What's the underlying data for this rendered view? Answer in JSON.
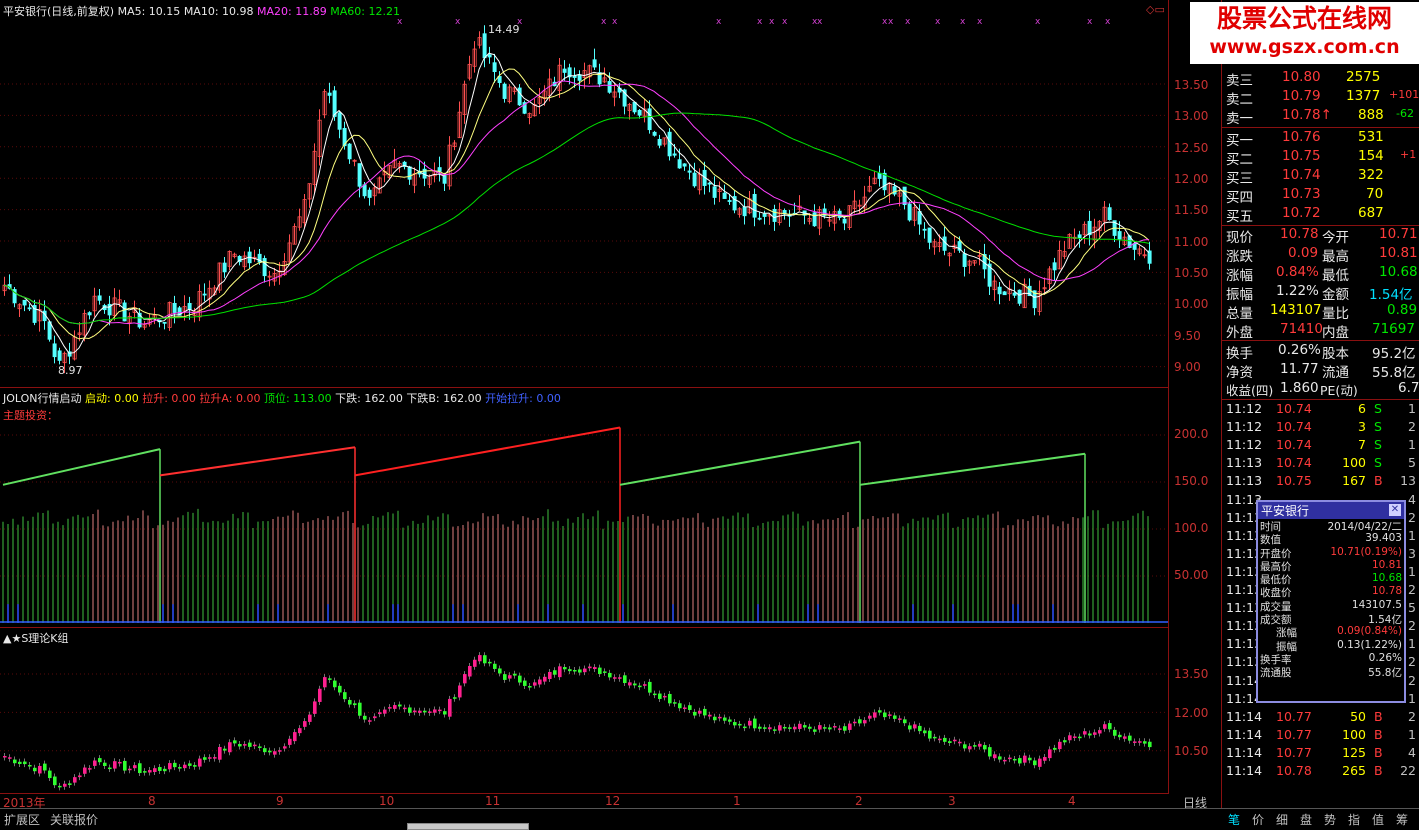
{
  "main_chart": {
    "stock_label": "平安银行(日线,前复权)",
    "ma5": "MA5: 10.15",
    "ma10": "MA10: 10.98",
    "ma20": "MA20: 11.89",
    "ma60": "MA60: 12.21",
    "high_mark": "14.49",
    "low_mark": "8.97",
    "y_ticks": [
      "13.50",
      "13.00",
      "12.50",
      "12.00",
      "11.50",
      "11.00",
      "10.50",
      "10.00",
      "9.50",
      "9.00"
    ]
  },
  "indicator_panel": {
    "name": "JOLON行情启动",
    "qidong": "启动: 0.00",
    "lasheng": "拉升: 0.00",
    "lashenga": "拉升A: 0.00",
    "dingwei": "顶位: 113.00",
    "xiadie": "下跌: 162.00",
    "xiadieb": "下跌B: 162.00",
    "kaishi": "开始拉升: 0.00",
    "theme": "主题投资：",
    "y_ticks": [
      "200.0",
      "150.0",
      "100.0",
      "50.00"
    ]
  },
  "k_panel": {
    "name": "▲★S理论K组",
    "y_ticks": [
      "13.50",
      "12.00",
      "10.50"
    ]
  },
  "x_axis": {
    "labels": [
      "2013年",
      "8",
      "9",
      "10",
      "11",
      "12",
      "1",
      "2",
      "3",
      "4"
    ],
    "period": "日线"
  },
  "watermark": {
    "title": "股票公式在线网",
    "url": "www.gszx.com.cn"
  },
  "quotes": {
    "asks": [
      {
        "label": "卖三",
        "price": "10.80",
        "vol": "2575",
        "chg": ""
      },
      {
        "label": "卖二",
        "price": "10.79",
        "vol": "1377",
        "chg": "+101"
      },
      {
        "label": "卖一",
        "price": "10.78↑",
        "vol": "888",
        "chg": "-62"
      }
    ],
    "bids": [
      {
        "label": "买一",
        "price": "10.76",
        "vol": "531",
        "chg": ""
      },
      {
        "label": "买二",
        "price": "10.75",
        "vol": "154",
        "chg": "+1"
      },
      {
        "label": "买三",
        "price": "10.74",
        "vol": "322",
        "chg": ""
      },
      {
        "label": "买四",
        "price": "10.73",
        "vol": "70",
        "chg": ""
      },
      {
        "label": "买五",
        "price": "10.72",
        "vol": "687",
        "chg": ""
      }
    ],
    "stats": [
      {
        "l1": "现价",
        "v1": "10.78",
        "l2": "今开",
        "v2": "10.71"
      },
      {
        "l1": "涨跌",
        "v1": "0.09",
        "l2": "最高",
        "v2": "10.81"
      },
      {
        "l1": "涨幅",
        "v1": "0.84%",
        "l2": "最低",
        "v2": "10.68"
      },
      {
        "l1": "振幅",
        "v1": "1.22%",
        "l2": "金额",
        "v2": "1.54亿"
      },
      {
        "l1": "总量",
        "v1": "143107",
        "l2": "量比",
        "v2": "0.89"
      },
      {
        "l1": "外盘",
        "v1": "71410",
        "l2": "内盘",
        "v2": "71697"
      },
      {
        "l1": "换手",
        "v1": "0.26%",
        "l2": "股本",
        "v2": "95.2亿"
      },
      {
        "l1": "净资",
        "v1": "11.77",
        "l2": "流通",
        "v2": "55.8亿"
      },
      {
        "l1": "收益(四)",
        "v1": "1.860",
        "l2": "PE(动)",
        "v2": "6.7"
      }
    ]
  },
  "ticks": [
    {
      "t": "11:12",
      "p": "10.74",
      "v": "6",
      "s": "S",
      "n": "1"
    },
    {
      "t": "11:12",
      "p": "10.74",
      "v": "3",
      "s": "S",
      "n": "2"
    },
    {
      "t": "11:12",
      "p": "10.74",
      "v": "7",
      "s": "S",
      "n": "1"
    },
    {
      "t": "11:13",
      "p": "10.74",
      "v": "100",
      "s": "S",
      "n": "5"
    },
    {
      "t": "11:13",
      "p": "10.75",
      "v": "167",
      "s": "B",
      "n": "13"
    },
    {
      "t": "11:13",
      "p": "",
      "v": "",
      "s": "",
      "n": "4"
    },
    {
      "t": "11:13",
      "p": "",
      "v": "",
      "s": "",
      "n": "2"
    },
    {
      "t": "11:13",
      "p": "",
      "v": "",
      "s": "",
      "n": "1"
    },
    {
      "t": "11:13",
      "p": "",
      "v": "",
      "s": "",
      "n": "3"
    },
    {
      "t": "11:13",
      "p": "",
      "v": "",
      "s": "",
      "n": "1"
    },
    {
      "t": "11:13",
      "p": "",
      "v": "",
      "s": "",
      "n": "2"
    },
    {
      "t": "11:13",
      "p": "",
      "v": "",
      "s": "",
      "n": "5"
    },
    {
      "t": "11:13",
      "p": "",
      "v": "",
      "s": "",
      "n": "2"
    },
    {
      "t": "11:13",
      "p": "",
      "v": "",
      "s": "",
      "n": "1"
    },
    {
      "t": "11:13",
      "p": "",
      "v": "",
      "s": "",
      "n": "2"
    },
    {
      "t": "11:14",
      "p": "",
      "v": "",
      "s": "",
      "n": "2"
    },
    {
      "t": "11:14",
      "p": "10.76",
      "v": "50",
      "s": "S",
      "n": "1"
    },
    {
      "t": "11:14",
      "p": "10.77",
      "v": "50",
      "s": "B",
      "n": "2"
    },
    {
      "t": "11:14",
      "p": "10.77",
      "v": "100",
      "s": "B",
      "n": "1"
    },
    {
      "t": "11:14",
      "p": "10.77",
      "v": "125",
      "s": "B",
      "n": "4"
    },
    {
      "t": "11:14",
      "p": "10.78",
      "v": "265",
      "s": "B",
      "n": "22"
    }
  ],
  "tooltip": {
    "title": "平安银行",
    "rows": [
      {
        "k": "时间",
        "v": "2014/04/22/二",
        "c": "#e0e0e0"
      },
      {
        "k": "数值",
        "v": "39.403",
        "c": "#e0e0e0"
      },
      {
        "k": "开盘价",
        "v": "10.71(0.19%)",
        "c": "#ff3b3b"
      },
      {
        "k": "最高价",
        "v": "10.81",
        "c": "#ff3b3b"
      },
      {
        "k": "最低价",
        "v": "10.68",
        "c": "#00e600"
      },
      {
        "k": "收盘价",
        "v": "10.78",
        "c": "#ff3b3b"
      },
      {
        "k": "成交量",
        "v": "143107.5",
        "c": "#e0e0e0"
      },
      {
        "k": "成交额",
        "v": "1.54亿",
        "c": "#e0e0e0"
      },
      {
        "k": "涨幅",
        "v": "0.09(0.84%)",
        "c": "#ff3b3b"
      },
      {
        "k": "振幅",
        "v": "0.13(1.22%)",
        "c": "#e0e0e0"
      },
      {
        "k": "换手率",
        "v": "0.26%",
        "c": "#e0e0e0"
      },
      {
        "k": "流通股",
        "v": "55.8亿",
        "c": "#e0e0e0"
      }
    ]
  },
  "bottom": {
    "left_tabs": [
      "扩展区",
      "关联报价"
    ],
    "right_tabs": [
      "笔",
      "价",
      "细",
      "盘",
      "势",
      "指",
      "值",
      "筹"
    ]
  }
}
